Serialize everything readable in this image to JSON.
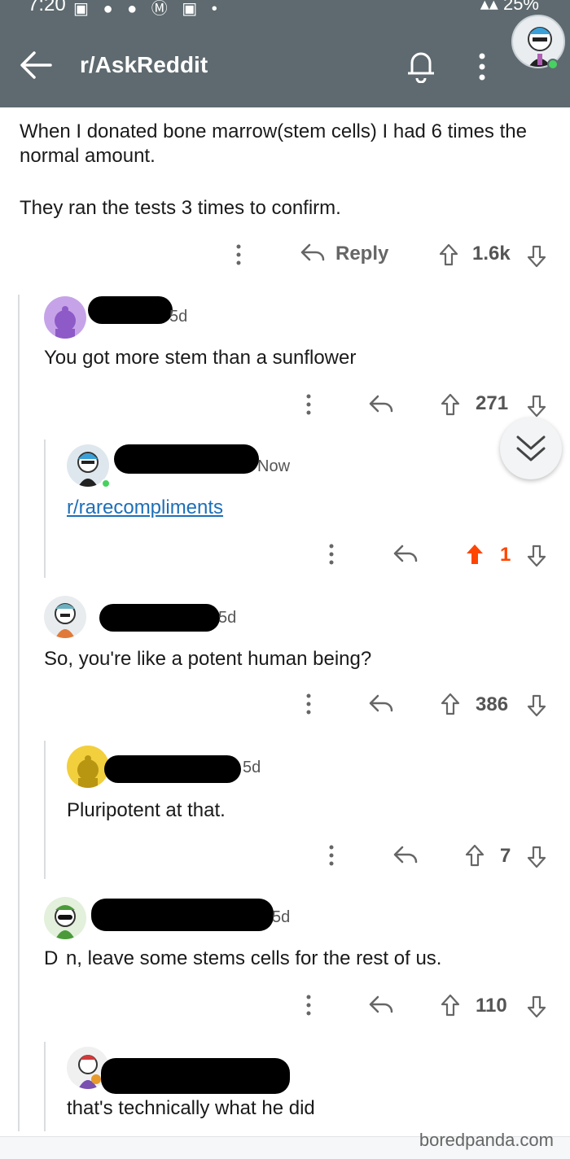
{
  "status_bar": {
    "time": "7:20",
    "battery": "25%"
  },
  "header": {
    "subreddit": "r/AskReddit"
  },
  "post": {
    "body_line1": "When I donated bone marrow(stem cells) I had 6 times the",
    "body_line2": "normal amount.",
    "body_line3": "They ran the tests 3 times to confirm.",
    "reply_label": "Reply",
    "votes": "1.6k"
  },
  "comments": [
    {
      "time": "5d",
      "text": "You got more stem than a sunflower",
      "votes": "271"
    },
    {
      "time": "Now",
      "text": "r/rarecompliments",
      "votes": "1"
    },
    {
      "time": "5d",
      "text": "So, you're like a potent human being?",
      "votes": "386"
    },
    {
      "time": "5d",
      "text": "Pluripotent at that.",
      "votes": "7"
    },
    {
      "time": "5d",
      "text": "D  n, leave some stems cells for the rest of us.",
      "votes": "110"
    },
    {
      "time": "",
      "text": "that's technically what he did",
      "votes": ""
    }
  ],
  "watermark": "boredpanda.com",
  "colors": {
    "header": "#5e6a6f",
    "upvote_active": "#ff4500",
    "link": "#1d6fb8"
  }
}
